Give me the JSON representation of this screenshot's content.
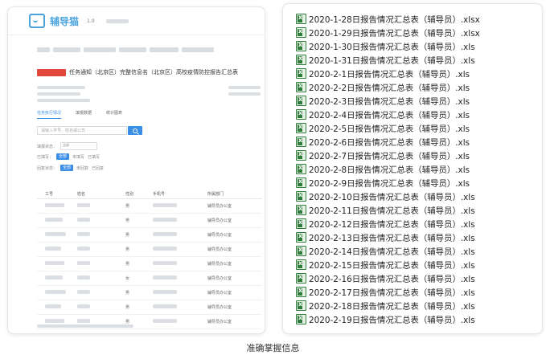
{
  "app": {
    "logo_text": "辅导猫",
    "version": "1.0",
    "title": "任务通知（北京区）完整信息名（北京区）高校疫情防控报告汇总表"
  },
  "tabs": [
    "任务执行情况",
    "填报数据",
    "统计图表"
  ],
  "search": {
    "placeholder": "请输入学号、姓名或公司"
  },
  "filters": {
    "status_label": "填报状态：",
    "status_value": "全部",
    "submit_label": "已填写：",
    "submit_options": [
      "全部",
      "未填写",
      "已填写"
    ],
    "reply_label": "回复状态：",
    "reply_options": [
      "全部",
      "未回复",
      "已回复"
    ]
  },
  "table": {
    "headers": [
      "工号",
      "姓名",
      "性别",
      "手机号",
      "所属部门"
    ],
    "rows": [
      {
        "gender": "男",
        "dept": "辅导员办公室"
      },
      {
        "gender": "男",
        "dept": "辅导员办公室"
      },
      {
        "gender": "男",
        "dept": "辅导员办公室"
      },
      {
        "gender": "男",
        "dept": "辅导员办公室"
      },
      {
        "gender": "男",
        "dept": "辅导员办公室"
      },
      {
        "gender": "女",
        "dept": "辅导员办公室"
      },
      {
        "gender": "男",
        "dept": "辅导员办公室"
      },
      {
        "gender": "男",
        "dept": "辅导员办公室"
      },
      {
        "gender": "男",
        "dept": "辅导员办公室"
      },
      {
        "gender": "男",
        "dept": "辅导员办公室"
      }
    ]
  },
  "files": [
    "2020-1-28日报告情况汇总表（辅导员）.xlsx",
    "2020-1-29日报告情况汇总表（辅导员）.xlsx",
    "2020-1-30日报告情况汇总表（辅导员）.xls",
    "2020-1-31日报告情况汇总表（辅导员）.xls",
    "2020-2-1日报告情况汇总表（辅导员）.xls",
    "2020-2-2日报告情况汇总表（辅导员）.xls",
    "2020-2-3日报告情况汇总表（辅导员）.xls",
    "2020-2-4日报告情况汇总表（辅导员）.xls",
    "2020-2-5日报告情况汇总表（辅导员）.xls",
    "2020-2-6日报告情况汇总表（辅导员）.xls",
    "2020-2-7日报告情况汇总表（辅导员）.xls",
    "2020-2-8日报告情况汇总表（辅导员）.xls",
    "2020-2-9日报告情况汇总表（辅导员）.xls",
    "2020-2-10日报告情况汇总表（辅导员）.xls",
    "2020-2-11日报告情况汇总表（辅导员）.xls",
    "2020-2-12日报告情况汇总表（辅导员）.xls",
    "2020-2-13日报告情况汇总表（辅导员）.xls",
    "2020-2-14日报告情况汇总表（辅导员）.xls",
    "2020-2-15日报告情况汇总表（辅导员）.xls",
    "2020-2-16日报告情况汇总表（辅导员）.xls",
    "2020-2-17日报告情况汇总表（辅导员）.xls",
    "2020-2-18日报告情况汇总表（辅导员）.xls",
    "2020-2-19日报告情况汇总表（辅导员）.xls"
  ],
  "caption": "准确掌握信息",
  "colors": {
    "accent": "#3a8ee6",
    "tag": "#e0483e",
    "excel": "#2f7d3a"
  }
}
